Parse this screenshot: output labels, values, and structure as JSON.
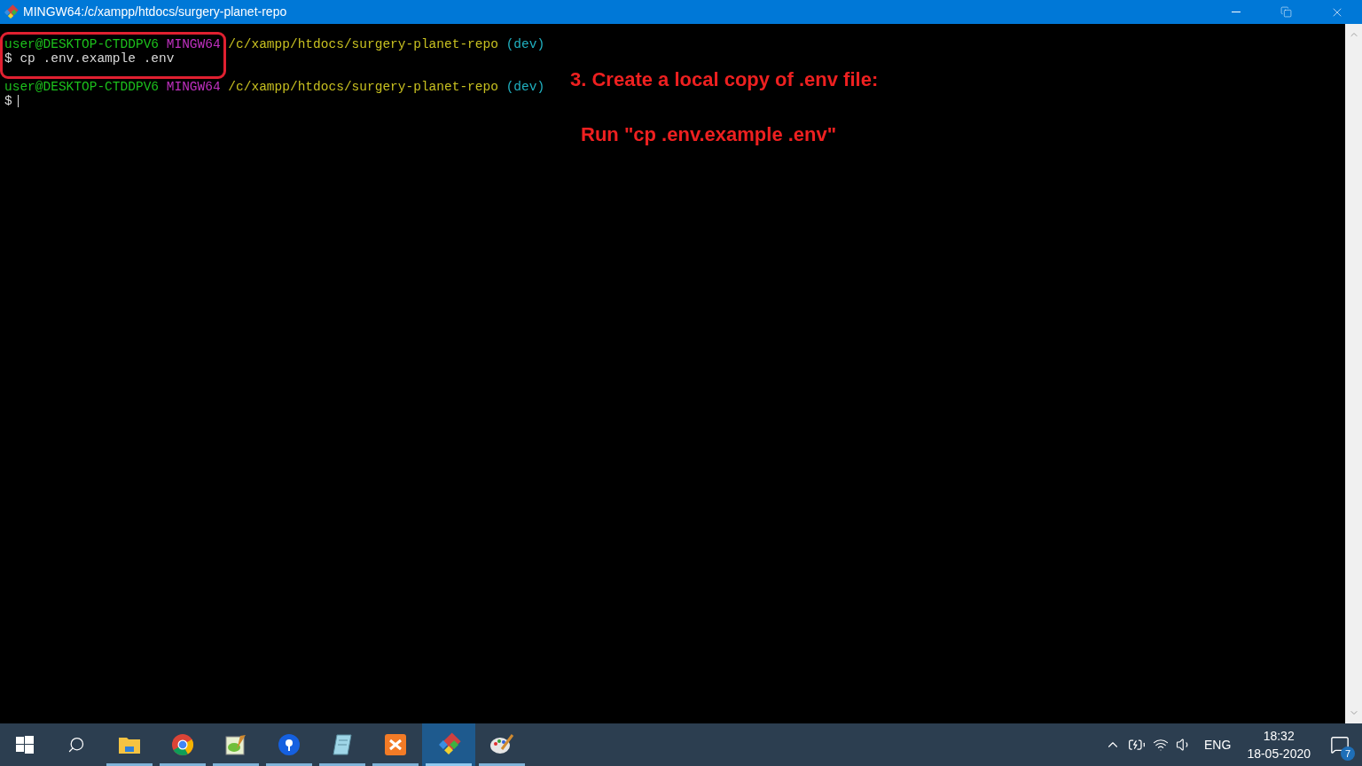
{
  "window": {
    "title": "MINGW64:/c/xampp/htdocs/surgery-planet-repo"
  },
  "terminal": {
    "lines": [
      {
        "kind": "prompt",
        "user": "user@DESKTOP-CTDDPV6",
        "system": "MINGW64",
        "path": "/c/xampp/htdocs/surgery-planet-repo",
        "branch": "(dev)"
      },
      {
        "kind": "command",
        "symbol": "$",
        "text": "cp .env.example .env"
      },
      {
        "kind": "blank"
      },
      {
        "kind": "prompt",
        "user": "user@DESKTOP-CTDDPV6",
        "system": "MINGW64",
        "path": "/c/xampp/htdocs/surgery-planet-repo",
        "branch": "(dev)"
      },
      {
        "kind": "input",
        "symbol": "$"
      }
    ]
  },
  "annotation": {
    "heading": "3. Create a local copy of .env file:",
    "instruction": "Run \"cp .env.example .env\""
  },
  "taskbar": {
    "apps": [
      {
        "kind": "folder",
        "selected": false
      },
      {
        "kind": "browser",
        "selected": false
      },
      {
        "kind": "editor",
        "selected": false
      },
      {
        "kind": "pin",
        "selected": false
      },
      {
        "kind": "notepad",
        "selected": false
      },
      {
        "kind": "server",
        "selected": false
      },
      {
        "kind": "git",
        "selected": true
      },
      {
        "kind": "paint",
        "selected": false
      }
    ],
    "tray": {
      "language": "ENG",
      "time": "18:32",
      "date": "18-05-2020",
      "notifications": "7"
    }
  }
}
